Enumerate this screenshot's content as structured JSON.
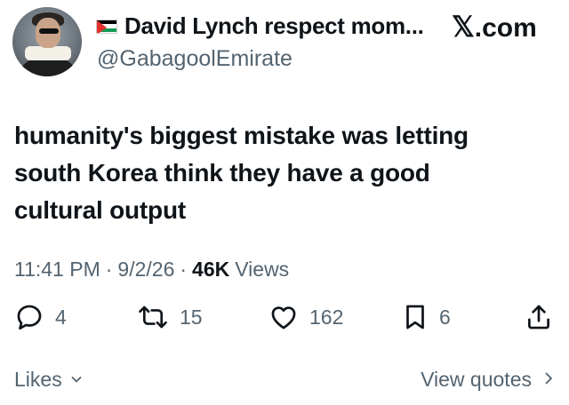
{
  "author": {
    "display_name": "David Lynch respect mom...",
    "handle": "@GabagoolEmirate",
    "flag_icon": "palestine-flag-icon"
  },
  "brand": {
    "mark": "𝕏",
    "suffix": ".com"
  },
  "tweet": {
    "text_lines": [
      "humanity's biggest mistake was letting",
      "south Korea think they have a good",
      "cultural output"
    ],
    "time": "11:41 PM",
    "date": "9/2/26",
    "views_count": "46K",
    "views_label": "Views"
  },
  "actions": {
    "replies": "4",
    "reposts": "15",
    "likes": "162",
    "bookmarks": "6"
  },
  "footer": {
    "likes_label": "Likes",
    "quotes_label": "View quotes"
  },
  "colors": {
    "text": "#0f1419",
    "secondary": "#536471",
    "background": "#ffffff"
  }
}
